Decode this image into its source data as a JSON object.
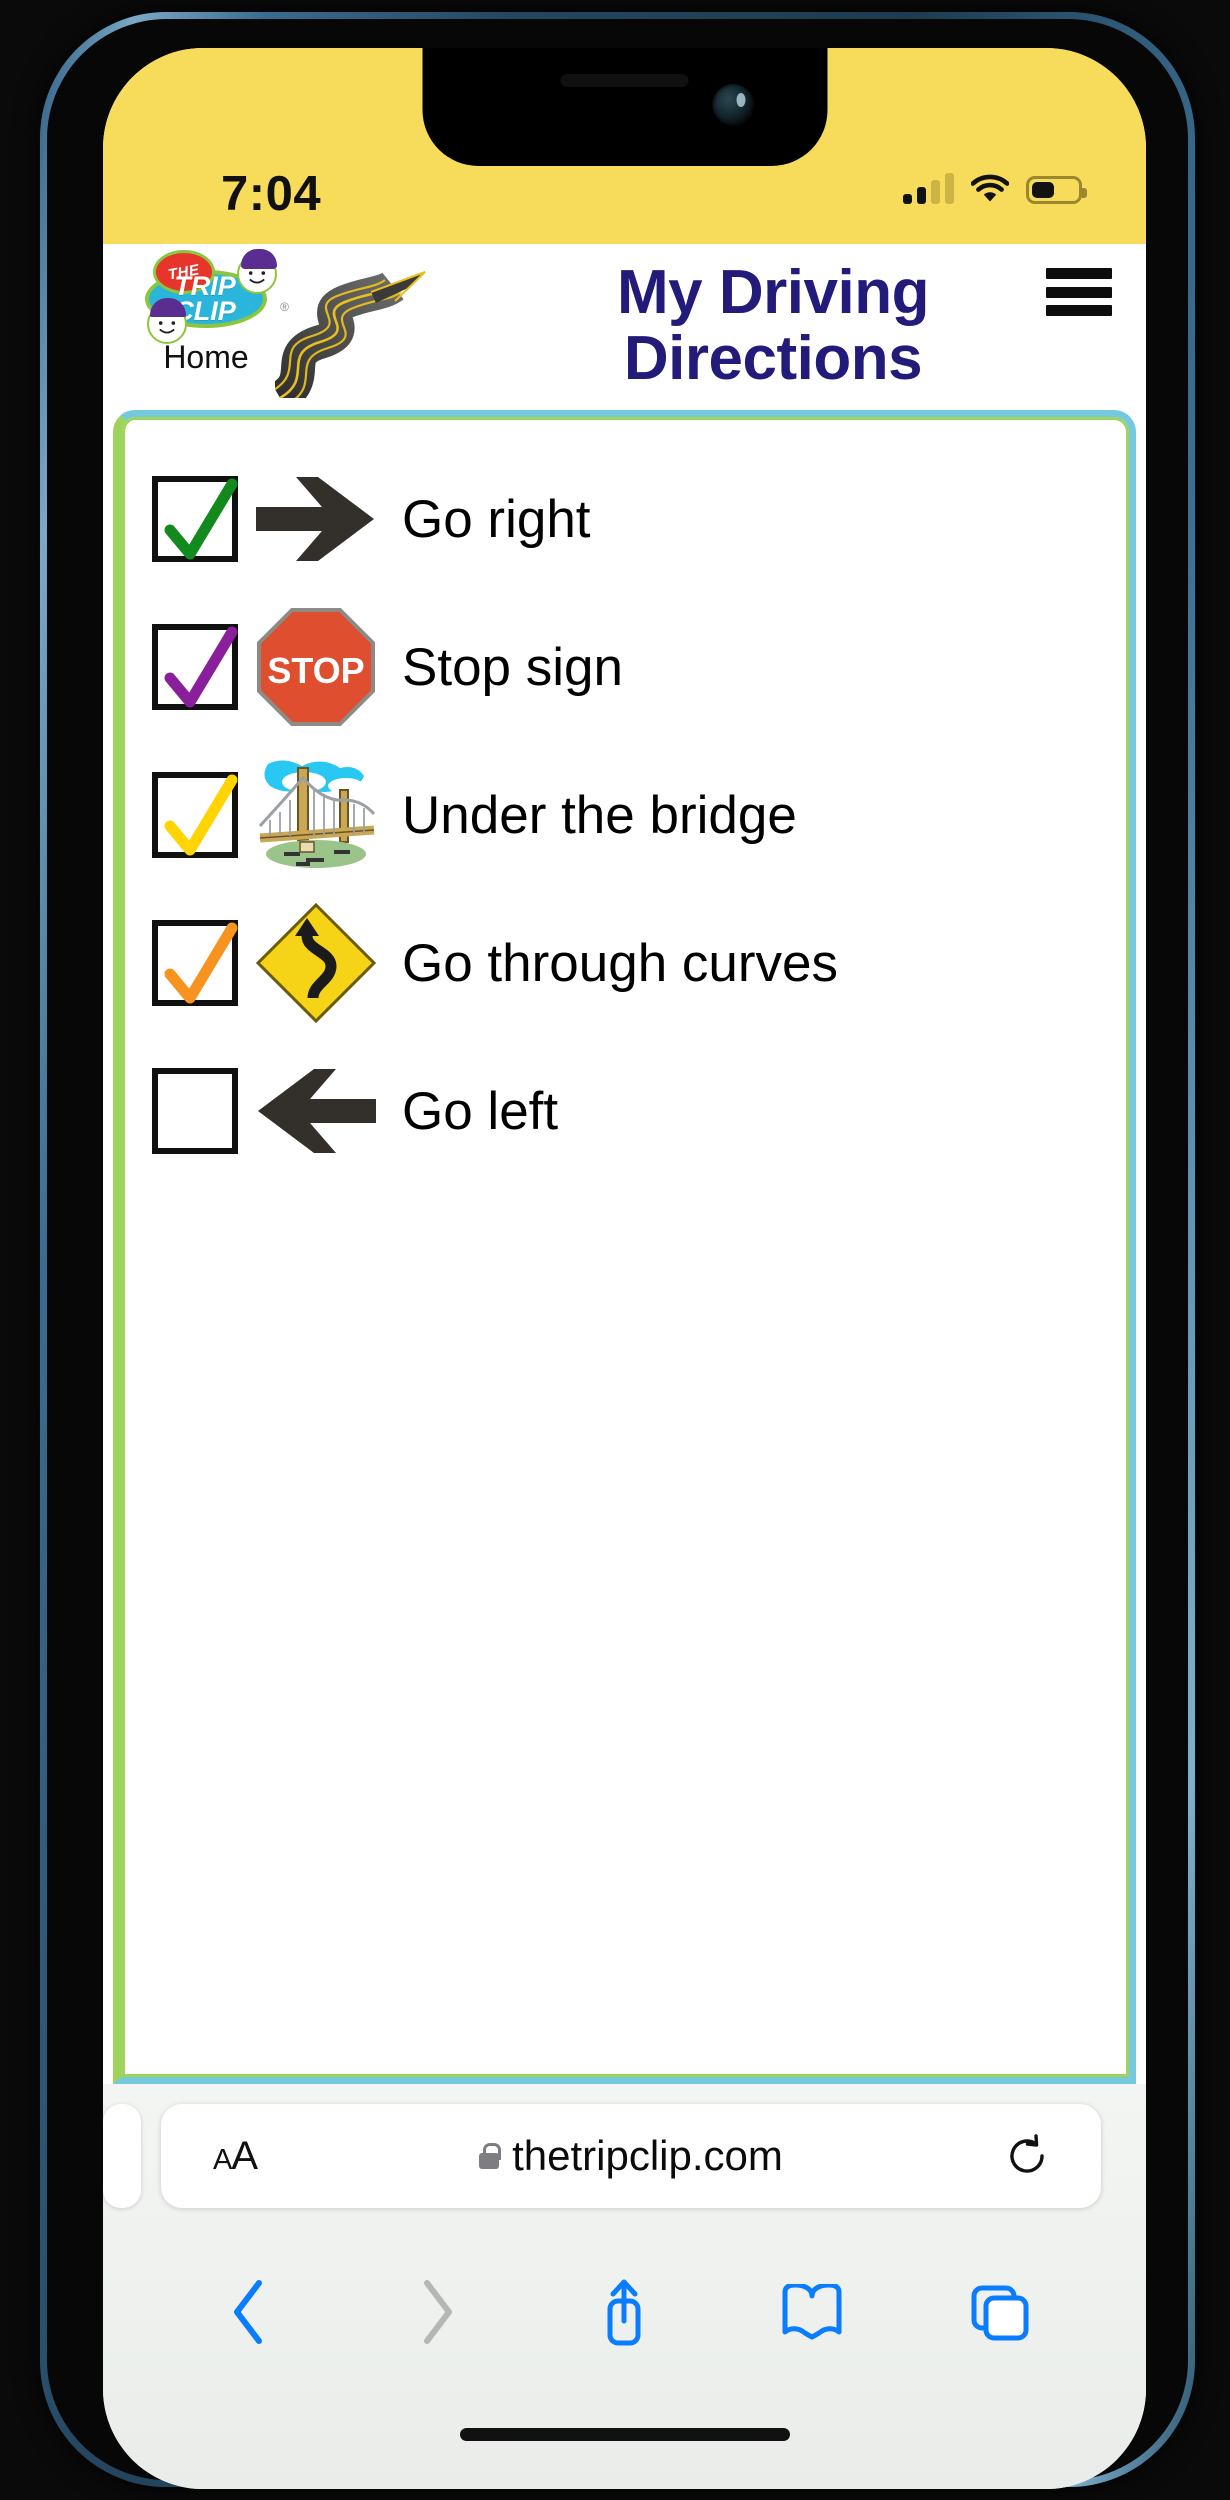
{
  "device": {
    "status_bar": {
      "time": "7:04",
      "signal_icon": "cellular-signal-icon",
      "signal_bars_filled": 2,
      "signal_bars_total": 4,
      "wifi_icon": "wifi-icon",
      "battery_icon": "battery-icon",
      "battery_percent": 45,
      "background_color": "#f7dc5b"
    }
  },
  "header": {
    "logo": {
      "name": "the-trip-clip-logo",
      "word_the": "THE",
      "word_trip": "TRIP",
      "word_clip": "CLIP",
      "registered_mark": "®"
    },
    "home_label": "Home",
    "title": "My Driving Directions",
    "title_color": "#221b7a",
    "road_image_name": "winding-road-illustration",
    "menu_icon": "hamburger-menu-icon"
  },
  "list": {
    "border_color_outer": "#9fd45c",
    "border_color_inner": "#76c8de",
    "items": [
      {
        "label": "Go right",
        "checked": true,
        "check_color": "#128a1e",
        "icon_name": "right-arrow-icon"
      },
      {
        "label": "Stop sign",
        "checked": true,
        "check_color": "#8a1f9c",
        "icon_name": "stop-sign-icon",
        "sign_text": "STOP",
        "sign_color": "#e04e30"
      },
      {
        "label": "Under the bridge",
        "checked": true,
        "check_color": "#ffd400",
        "icon_name": "suspension-bridge-icon"
      },
      {
        "label": "Go through curves",
        "checked": true,
        "check_color": "#f7931e",
        "icon_name": "winding-road-sign-icon",
        "sign_color": "#f5d417"
      },
      {
        "label": "Go left",
        "checked": false,
        "check_color": "",
        "icon_name": "left-arrow-icon"
      }
    ]
  },
  "browser": {
    "text_size_label": "AA",
    "lock_icon": "lock-icon",
    "url": "thetripclip.com",
    "reload_icon": "reload-icon",
    "toolbar": [
      {
        "name": "back-button",
        "icon": "chevron-left-icon",
        "enabled": true
      },
      {
        "name": "forward-button",
        "icon": "chevron-right-icon",
        "enabled": false
      },
      {
        "name": "share-button",
        "icon": "share-icon",
        "enabled": true
      },
      {
        "name": "bookmarks-button",
        "icon": "book-icon",
        "enabled": true
      },
      {
        "name": "tabs-button",
        "icon": "tabs-icon",
        "enabled": true
      }
    ],
    "accent_color": "#0a7cff",
    "disabled_color": "#b6b6b6"
  }
}
